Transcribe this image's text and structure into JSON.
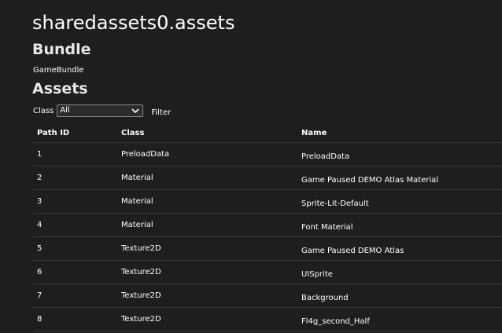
{
  "page": {
    "title": "sharedassets0.assets"
  },
  "bundle": {
    "heading": "Bundle",
    "name": "GameBundle"
  },
  "assets": {
    "heading": "Assets",
    "filter": {
      "class_label": "Class",
      "class_value": "All",
      "filter_label": "Filter"
    },
    "columns": [
      "Path ID",
      "Class",
      "Name"
    ],
    "rows": [
      {
        "path_id": "1",
        "class": "PreloadData",
        "name": "PreloadData"
      },
      {
        "path_id": "2",
        "class": "Material",
        "name": "Game Paused DEMO Atlas Material"
      },
      {
        "path_id": "3",
        "class": "Material",
        "name": "Sprite-Lit-Default"
      },
      {
        "path_id": "4",
        "class": "Material",
        "name": "Font Material"
      },
      {
        "path_id": "5",
        "class": "Texture2D",
        "name": "Game Paused DEMO Atlas"
      },
      {
        "path_id": "6",
        "class": "Texture2D",
        "name": "UISprite"
      },
      {
        "path_id": "7",
        "class": "Texture2D",
        "name": "Background"
      },
      {
        "path_id": "8",
        "class": "Texture2D",
        "name": "Fl4g_second_Half"
      }
    ]
  },
  "colors": {
    "background": "#1e1e1e",
    "text": "#ffffff",
    "row_divider": "#3a3a3a"
  }
}
